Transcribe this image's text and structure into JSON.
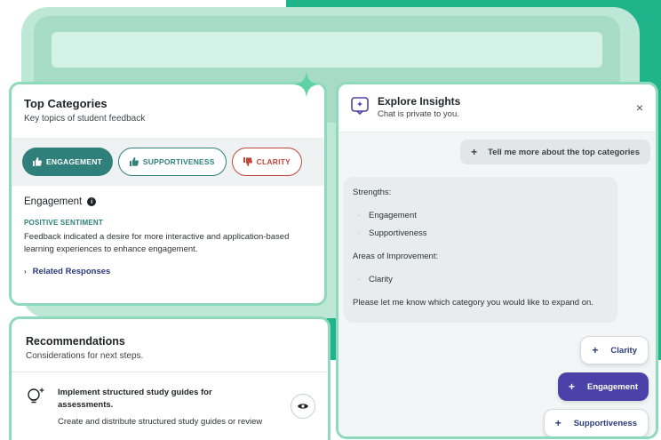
{
  "categories": {
    "title": "Top Categories",
    "subtitle": "Key topics of student feedback",
    "chips": [
      {
        "label": "ENGAGEMENT",
        "icon": "thumbs-up-icon",
        "state": "active"
      },
      {
        "label": "SUPPORTIVENESS",
        "icon": "thumbs-up-icon",
        "state": "outline"
      },
      {
        "label": "CLARITY",
        "icon": "thumbs-down-icon",
        "state": "negative"
      }
    ],
    "selected_name": "Engagement",
    "info_glyph": "i",
    "sentiment_label": "POSITIVE SENTIMENT",
    "feedback": "Feedback indicated a desire for more interactive and application-based learning experiences to enhance engagement.",
    "related_label": "Related Responses",
    "related_chevron": "›"
  },
  "recommendations": {
    "title": "Recommendations",
    "subtitle": "Considerations for next steps.",
    "item": {
      "title": "Implement structured study guides for assessments.",
      "description": "Create and distribute structured study guides or review"
    }
  },
  "insights": {
    "title": "Explore Insights",
    "subtitle": "Chat is private to you.",
    "close_glyph": "×",
    "user_message": "Tell me more about the top categories",
    "plus_glyph": "+",
    "bot": {
      "strengths_label": "Strengths:",
      "strengths": [
        "Engagement",
        "Supportiveness"
      ],
      "improvement_label": "Areas of Improvement:",
      "improvements": [
        "Clarity"
      ],
      "closing": "Please let me know which category you would like to expand on."
    },
    "suggestions": [
      {
        "label": "Clarity",
        "state": "default"
      },
      {
        "label": "Engagement",
        "state": "active"
      },
      {
        "label": "Supportiveness",
        "state": "default"
      }
    ]
  },
  "colors": {
    "accent_teal": "#2f7f7a",
    "negative_red": "#c2473a",
    "brand_green": "#1fb48a",
    "active_purple": "#4a42a8"
  }
}
